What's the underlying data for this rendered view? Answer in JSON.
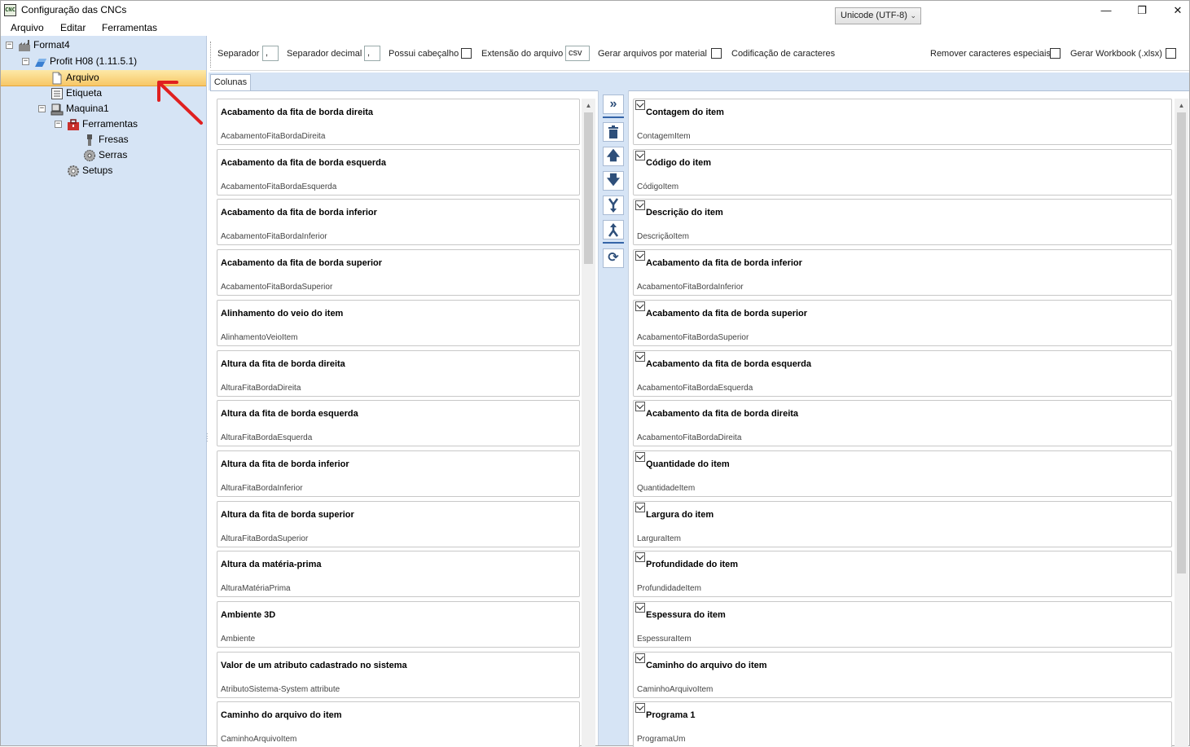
{
  "window": {
    "title": "Configuração das CNCs",
    "app_icon_text": "CNC"
  },
  "menu": [
    "Arquivo",
    "Editar",
    "Ferramentas"
  ],
  "tree": {
    "root": "Format4",
    "profit": "Profit H08 (1.11.5.1)",
    "arquivo": "Arquivo",
    "etiqueta": "Etiqueta",
    "maquina": "Maquina1",
    "ferramentas": "Ferramentas",
    "fresas": "Fresas",
    "serras": "Serras",
    "setups": "Setups"
  },
  "toolbar": {
    "separador_label": "Separador",
    "separador_value": ",",
    "sep_decimal_label": "Separador decimal",
    "sep_decimal_value": ",",
    "cabecalho_label": "Possui cabeçalho",
    "extensao_label": "Extensão do arquivo",
    "extensao_value": "csv",
    "por_material_label": "Gerar arquivos por material",
    "codificacao_label": "Codificação de caracteres",
    "codificacao_value": "Unicode (UTF-8)",
    "remover_label": "Remover caracteres especiais",
    "workbook_label": "Gerar Workbook (.xlsx)"
  },
  "tabs": {
    "colunas": "Colunas"
  },
  "available_columns": [
    {
      "title": "Acabamento da fita de borda direita",
      "key": "AcabamentoFitaBordaDireita"
    },
    {
      "title": "Acabamento da fita de borda esquerda",
      "key": "AcabamentoFitaBordaEsquerda"
    },
    {
      "title": "Acabamento da fita de borda inferior",
      "key": "AcabamentoFitaBordaInferior"
    },
    {
      "title": "Acabamento da fita de borda superior",
      "key": "AcabamentoFitaBordaSuperior"
    },
    {
      "title": "Alinhamento do veio do item",
      "key": "AlinhamentoVeioItem"
    },
    {
      "title": "Altura da fita de borda direita",
      "key": "AlturaFitaBordaDireita"
    },
    {
      "title": "Altura da fita de borda esquerda",
      "key": "AlturaFitaBordaEsquerda"
    },
    {
      "title": "Altura da fita de borda inferior",
      "key": "AlturaFitaBordaInferior"
    },
    {
      "title": "Altura da fita de borda superior",
      "key": "AlturaFitaBordaSuperior"
    },
    {
      "title": "Altura da matéria-prima",
      "key": "AlturaMatériaPrima"
    },
    {
      "title": "Ambiente 3D",
      "key": "Ambiente"
    },
    {
      "title": "Valor de um atributo cadastrado no sistema",
      "key": "AtributoSistema-System attribute"
    },
    {
      "title": "Caminho do arquivo do item",
      "key": "CaminhoArquivoItem"
    }
  ],
  "selected_columns": [
    {
      "title": "Contagem do item",
      "key": "ContagemItem"
    },
    {
      "title": "Código do item",
      "key": "CódigoItem"
    },
    {
      "title": "Descrição do item",
      "key": "DescriçãoItem"
    },
    {
      "title": "Acabamento da fita de borda inferior",
      "key": "AcabamentoFitaBordaInferior"
    },
    {
      "title": "Acabamento da fita de borda superior",
      "key": "AcabamentoFitaBordaSuperior"
    },
    {
      "title": "Acabamento da fita de borda esquerda",
      "key": "AcabamentoFitaBordaEsquerda"
    },
    {
      "title": "Acabamento da fita de borda direita",
      "key": "AcabamentoFitaBordaDireita"
    },
    {
      "title": "Quantidade do item",
      "key": "QuantidadeItem"
    },
    {
      "title": "Largura do item",
      "key": "LarguraItem"
    },
    {
      "title": "Profundidade do item",
      "key": "ProfundidadeItem"
    },
    {
      "title": "Espessura do item",
      "key": "EspessuraItem"
    },
    {
      "title": "Caminho do arquivo do item",
      "key": "CaminhoArquivoItem"
    },
    {
      "title": "Programa 1",
      "key": "ProgramaUm"
    }
  ],
  "action_icons": [
    "add-all-icon",
    "delete-icon",
    "move-up-icon",
    "move-down-icon",
    "merge-icon",
    "split-icon",
    "refresh-icon"
  ]
}
